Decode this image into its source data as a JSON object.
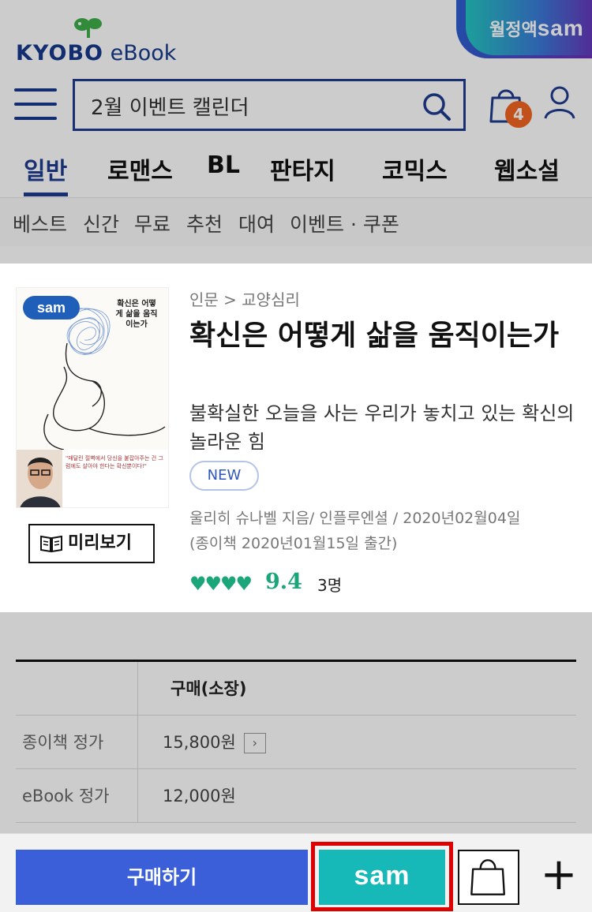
{
  "header": {
    "logo_brand": "KYOBO",
    "logo_product": "eBook",
    "sam_banner": {
      "prefix": "월정액",
      "brand": "sam"
    },
    "search": {
      "value": "2월 이벤트 캘린더",
      "placeholder": ""
    },
    "cart_count": "4",
    "accent_color": "#1f3d8f",
    "badge_color": "#f26522"
  },
  "category_tabs": [
    {
      "label": "일반",
      "active": true
    },
    {
      "label": "로맨스",
      "active": false
    },
    {
      "label": "BL",
      "active": false
    },
    {
      "label": "판타지",
      "active": false
    },
    {
      "label": "코믹스",
      "active": false
    },
    {
      "label": "웹소설",
      "active": false
    }
  ],
  "sub_nav": [
    "베스트",
    "신간",
    "무료",
    "추천",
    "대여",
    "이벤트 · 쿠폰"
  ],
  "book": {
    "breadcrumb": "인문 > 교양심리",
    "title": "확신은 어떻게 삶을 움직이는가",
    "subtitle": "불확실한 오늘을 사는 우리가 놓치고 있는 확신의 놀라운 힘",
    "badge": "NEW",
    "meta_line1": "울리히 슈나벨 지음/ 인플루엔셜 / 2020년02월04일",
    "meta_line2": "(종이책 2020년01월15일 출간)",
    "rating_hearts": "♥♥♥♥",
    "rating_score": "9.4",
    "rating_count": "3명",
    "preview_label": "미리보기",
    "cover": {
      "sam_tag": "sam",
      "title": "확신은 어떻게 삶을 움직이는가",
      "tagline": "\"매달린 절벽에서 당신을 붙잡아주는 건 그럼에도 살아야 한다는 확신뿐이다!\""
    },
    "rating_color": "#1aa57a"
  },
  "price_table": {
    "header": "구매(소장)",
    "rows": [
      {
        "label": "종이책 정가",
        "value": "15,800원",
        "arrow": "›"
      },
      {
        "label": "eBook 정가",
        "value": "12,000원"
      }
    ]
  },
  "bottom_bar": {
    "buy_label": "구매하기",
    "sam_label": "sam",
    "plus_label": "+",
    "buy_color": "#3b5fd9",
    "sam_color": "#16b9b7",
    "highlight_color": "#e00000"
  }
}
